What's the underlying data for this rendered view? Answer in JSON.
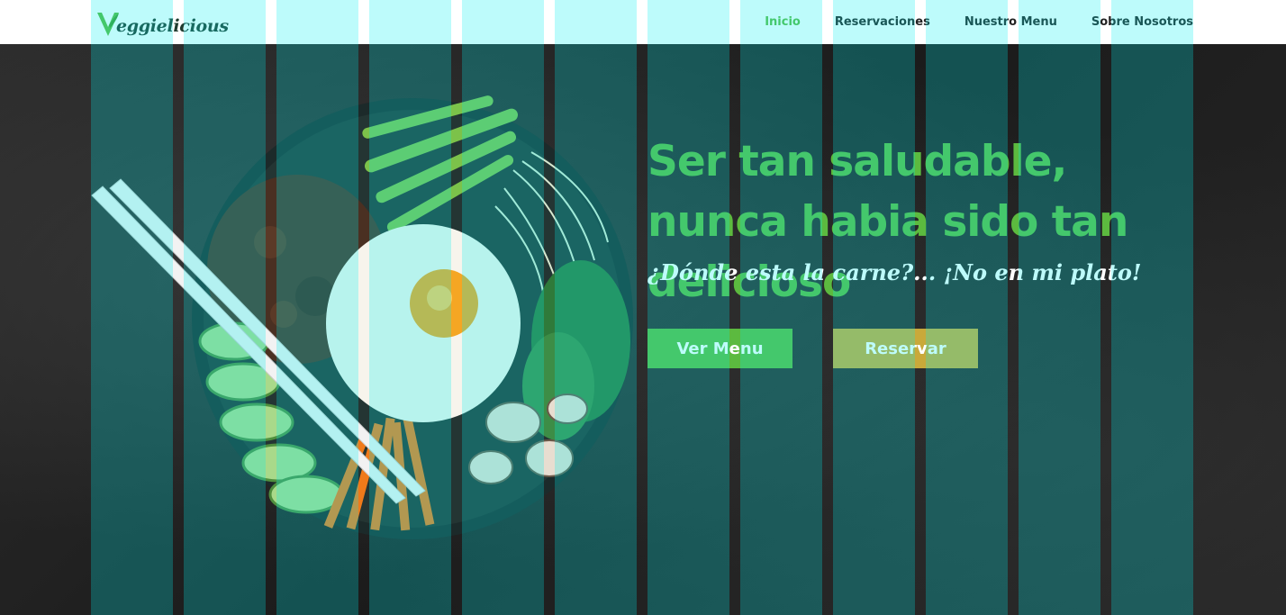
{
  "header": {
    "logo": {
      "text": "eggielicious",
      "icon": "leaf-v-icon",
      "color": "#5cba3f"
    },
    "nav": [
      {
        "label": "Inicio",
        "active": true
      },
      {
        "label": "Reservaciones",
        "active": false
      },
      {
        "label": "Nuestro Menu",
        "active": false
      },
      {
        "label": "Sobre Nosotros",
        "active": false
      }
    ]
  },
  "hero": {
    "headline": "Ser tan saludable, nunca habia sido tan delicioso",
    "tagline": "¿Dónde esta la carne?... ¡No en mi plato!",
    "buttons": {
      "menu_label": "Ver Menu",
      "reserve_label": "Reservar"
    },
    "image": "bibimbap-bowl-illustration"
  },
  "colors": {
    "accent": "#5cba3f",
    "secondary": "#c9a93a",
    "background": "#222222",
    "grid_overlay": "#00eeee"
  }
}
